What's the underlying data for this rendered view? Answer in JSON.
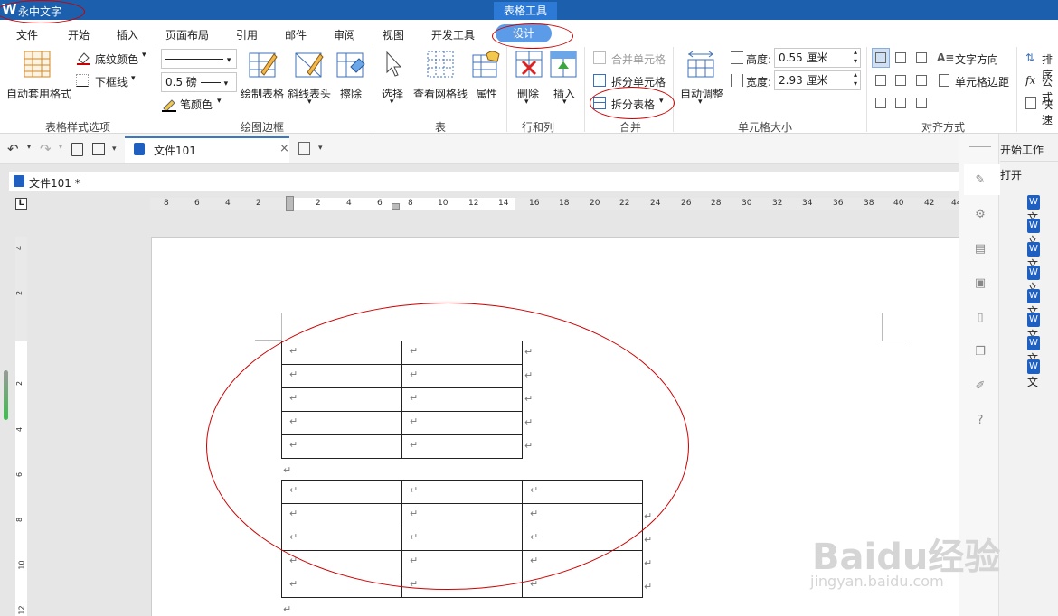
{
  "app": {
    "title": "永中文字",
    "logo": "W",
    "context_tab": "表格工具"
  },
  "menu": [
    "文件",
    "开始",
    "插入",
    "页面布局",
    "引用",
    "邮件",
    "审阅",
    "视图",
    "开发工具",
    "设计"
  ],
  "ribbon": {
    "style_group": {
      "auto_format": "自动套用格式",
      "shading": "底纹颜色",
      "border": "下框线",
      "label": "表格样式选项"
    },
    "draw_group": {
      "line_width": "0.5 磅",
      "pen_color": "笔颜色",
      "draw_table": "绘制表格",
      "diagonal": "斜线表头",
      "erase": "擦除",
      "label": "绘图边框"
    },
    "table_group": {
      "select": "选择",
      "gridlines": "查看网格线",
      "props": "属性",
      "label": "表"
    },
    "rowcol_group": {
      "delete": "删除",
      "insert": "插入",
      "label": "行和列"
    },
    "merge_group": {
      "merge": "合并单元格",
      "split_cell": "拆分单元格",
      "split_table": "拆分表格",
      "label": "合并"
    },
    "size_group": {
      "autofit": "自动调整",
      "height_label": "高度:",
      "height_value": "0.55 厘米",
      "width_label": "宽度:",
      "width_value": "2.93 厘米",
      "label": "单元格大小"
    },
    "align_group": {
      "text_dir": "文字方向",
      "cell_margin": "单元格边距",
      "label": "对齐方式"
    },
    "extra": {
      "sort": "排序",
      "formula": "公式",
      "quick": "快速"
    }
  },
  "quickbar": {
    "doc_tab": "文件101"
  },
  "inner_title": "文件101 *",
  "ruler_h": [
    "8",
    "6",
    "4",
    "2",
    "2",
    "4",
    "6",
    "8",
    "10",
    "12",
    "14",
    "16",
    "18",
    "20",
    "22",
    "24",
    "26",
    "28",
    "30",
    "32",
    "34",
    "36",
    "38",
    "40",
    "42",
    "44"
  ],
  "ruler_v": [
    "4",
    "2",
    "2",
    "4",
    "6",
    "8",
    "10",
    "12"
  ],
  "para_mark": "↵",
  "side": {
    "start_work": "开始工作",
    "open": "打开",
    "file_item": "文"
  },
  "watermark": {
    "brand": "Baidu经验",
    "url": "jingyan.baidu.com"
  }
}
